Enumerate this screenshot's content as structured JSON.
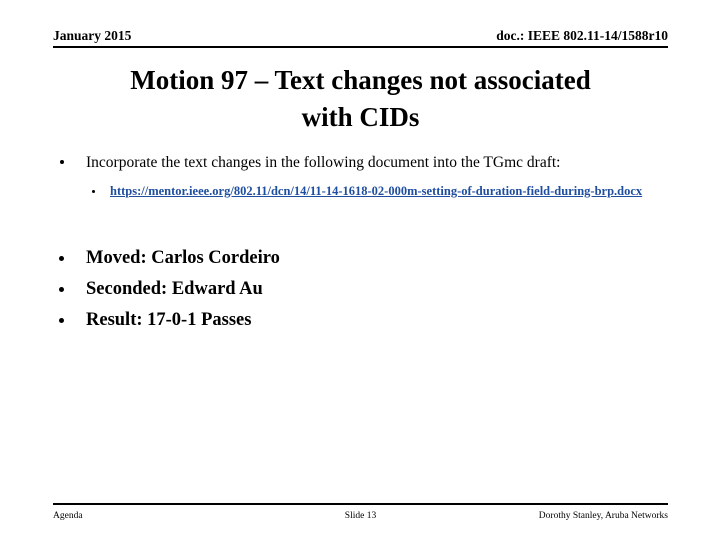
{
  "header": {
    "left": "January 2015",
    "right": "doc.: IEEE 802.11-14/1588r10"
  },
  "title": {
    "line1": "Motion  97  – Text changes not associated",
    "line2": "with CIDs",
    "full": "Motion  97  – Text changes not associated with CIDs"
  },
  "content": {
    "bullet1": "Incorporate the text changes in the following document into the TGmc draft:",
    "sub_bullet_link_text": "https://mentor.ieee.org/802.11/dcn/14/11-14-1618-02-000m-setting-of-duration-field-during-brp.docx",
    "motion": [
      "Moved: Carlos Cordeiro",
      "Seconded: Edward Au",
      "Result: 17-0-1 Passes"
    ]
  },
  "footer": {
    "left": "Agenda",
    "center": "Slide 13",
    "right": "Dorothy Stanley, Aruba Networks"
  },
  "colors": {
    "text": "#000000",
    "link": "#1F4E9E",
    "background": "#ffffff",
    "rule": "#000000"
  }
}
